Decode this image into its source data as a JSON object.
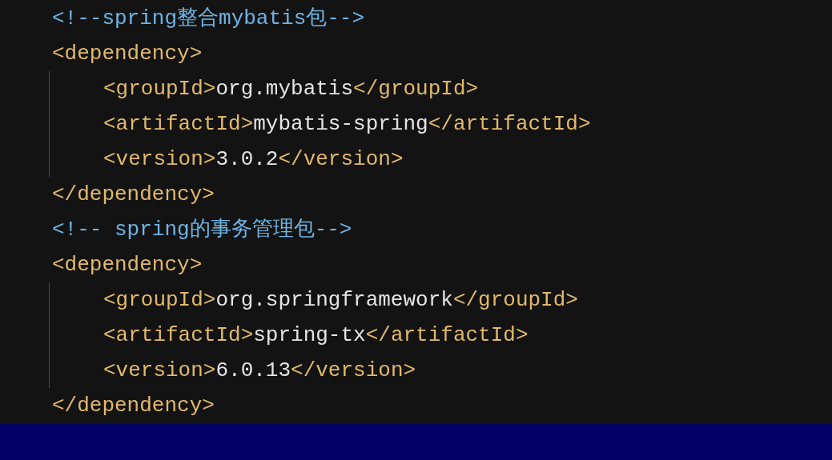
{
  "editor": {
    "blocks": [
      {
        "kind": "comment",
        "text": "<!--spring整合mybatis包-->"
      },
      {
        "kind": "element",
        "open": "<dependency>",
        "close": "</dependency>",
        "children": [
          {
            "open": "<groupId>",
            "value": "org.mybatis",
            "close": "</groupId>"
          },
          {
            "open": "<artifactId>",
            "value": "mybatis-spring",
            "close": "</artifactId>"
          },
          {
            "open": "<version>",
            "value": "3.0.2",
            "close": "</version>"
          }
        ]
      },
      {
        "kind": "comment",
        "text": "<!-- spring的事务管理包-->"
      },
      {
        "kind": "element",
        "open": "<dependency>",
        "close": "</dependency>",
        "children": [
          {
            "open": "<groupId>",
            "value": "org.springframework",
            "close": "</groupId>"
          },
          {
            "open": "<artifactId>",
            "value": "spring-tx",
            "close": "</artifactId>"
          },
          {
            "open": "<version>",
            "value": "6.0.13",
            "close": "</version>"
          }
        ]
      }
    ]
  }
}
